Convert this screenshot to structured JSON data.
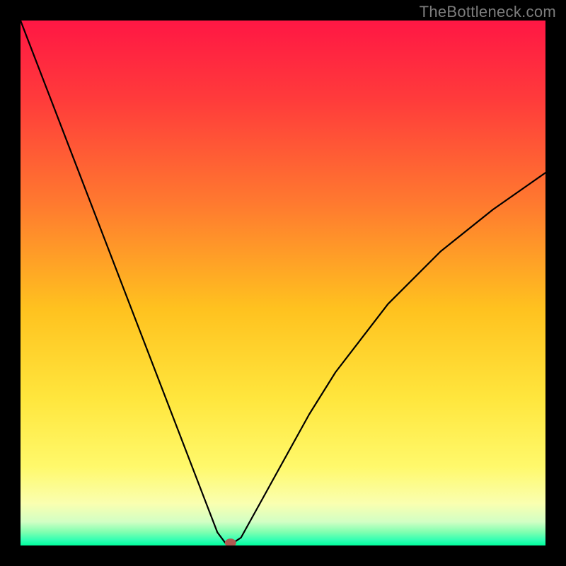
{
  "watermark": "TheBottleneck.com",
  "chart_data": {
    "type": "line",
    "title": "",
    "xlabel": "",
    "ylabel": "",
    "xlim": [
      0,
      100
    ],
    "ylim": [
      0,
      100
    ],
    "x": [
      0,
      5,
      10,
      15,
      20,
      25,
      30,
      35,
      37.5,
      39,
      40.5,
      42,
      55,
      60,
      70,
      80,
      90,
      100
    ],
    "values": [
      100,
      87,
      74,
      61,
      48,
      35,
      22,
      9,
      2.5,
      0.5,
      0.5,
      1.5,
      25,
      33,
      46,
      56,
      64,
      71
    ],
    "vertex_x": 40,
    "marker": {
      "x": 40,
      "y": 0.5,
      "color": "#b05a52",
      "rx": 8,
      "ry": 6
    },
    "gradient_stops": [
      {
        "offset": 0.0,
        "color": "#ff1744"
      },
      {
        "offset": 0.15,
        "color": "#ff3b3b"
      },
      {
        "offset": 0.35,
        "color": "#ff7a2f"
      },
      {
        "offset": 0.55,
        "color": "#ffc21f"
      },
      {
        "offset": 0.72,
        "color": "#ffe63d"
      },
      {
        "offset": 0.85,
        "color": "#fff96b"
      },
      {
        "offset": 0.92,
        "color": "#faffb0"
      },
      {
        "offset": 0.955,
        "color": "#d2ffc4"
      },
      {
        "offset": 0.975,
        "color": "#7dffb0"
      },
      {
        "offset": 0.99,
        "color": "#2fffb3"
      },
      {
        "offset": 1.0,
        "color": "#00ff9c"
      }
    ],
    "line_color": "#000000",
    "line_width": 2.2
  }
}
